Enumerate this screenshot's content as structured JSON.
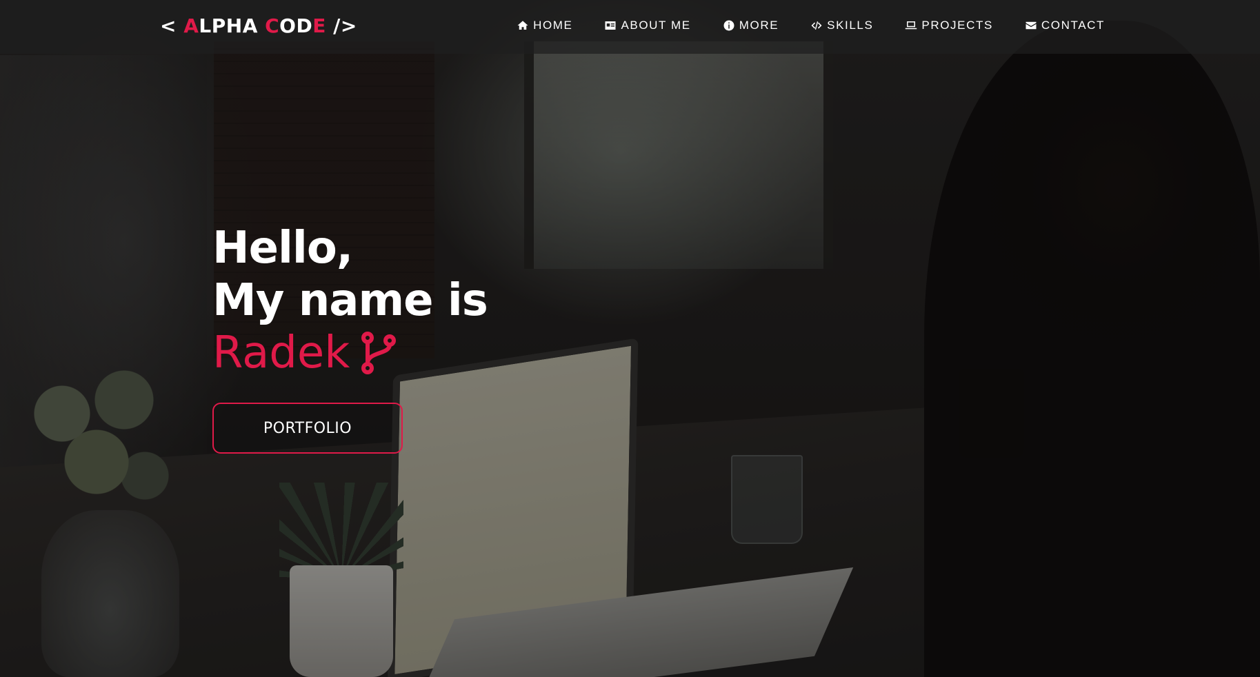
{
  "navbar": {
    "brand": {
      "open": "< ",
      "alpha_first": "A",
      "alpha_rest": "LPHA ",
      "code_first": "C",
      "code_mid": "OD",
      "code_last": "E",
      "close": " />"
    },
    "items": [
      {
        "label": "HOME",
        "icon": "home-icon"
      },
      {
        "label": "ABOUT ME",
        "icon": "id-card-icon"
      },
      {
        "label": "MORE",
        "icon": "info-circle-icon"
      },
      {
        "label": "SKILLS",
        "icon": "code-icon"
      },
      {
        "label": "PROJECTS",
        "icon": "laptop-icon"
      },
      {
        "label": "CONTACT",
        "icon": "envelope-icon"
      }
    ]
  },
  "hero": {
    "line1": "Hello,",
    "line2": "My name is",
    "name": "Radek",
    "name_icon": "code-branch-icon",
    "button_label": "PORTFOLIO"
  },
  "colors": {
    "accent": "#e01a49",
    "text": "#ffffff",
    "navbar_bg": "#1e1e1e"
  }
}
